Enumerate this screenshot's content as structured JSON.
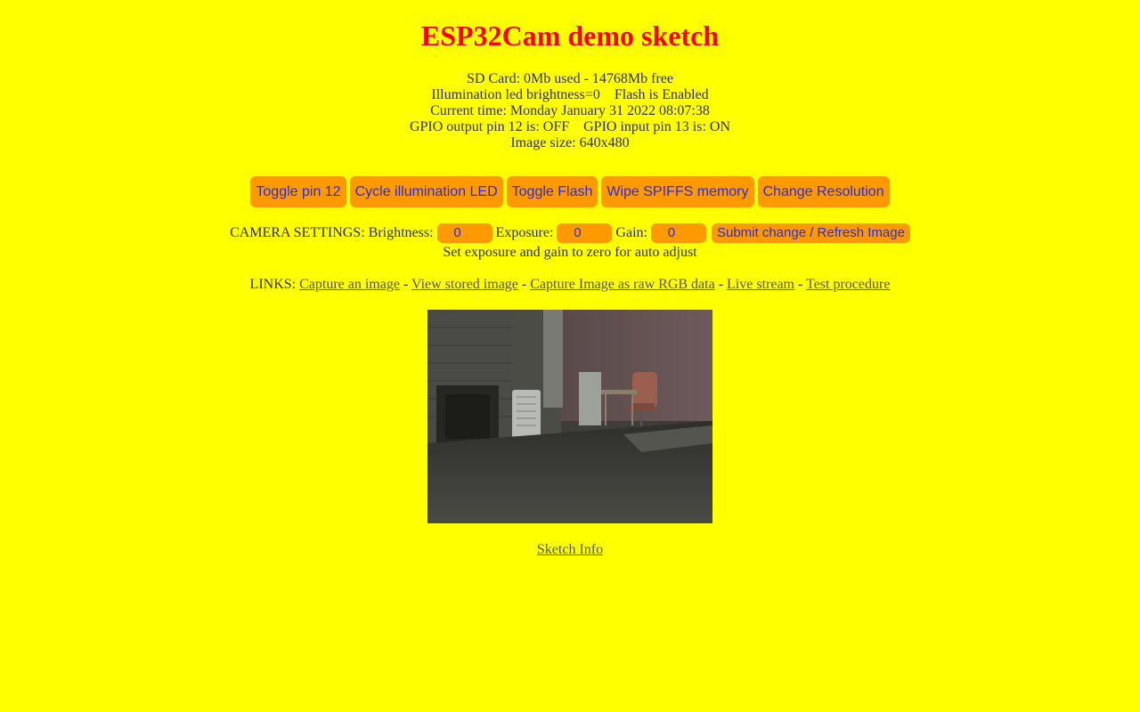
{
  "page": {
    "title": "ESP32Cam demo sketch",
    "background_color": "#ffff00",
    "title_color": "#ff0000",
    "button_color": "#ff9900",
    "button_text_color": "#2b2bd6"
  },
  "status": {
    "sd_card": "SD Card: 0Mb used - 14768Mb free",
    "illumination": "Illumination led brightness=0",
    "flash": "Flash is Enabled",
    "current_time": "Current time: Monday January 31 2022 08:07:38",
    "gpio_output": "GPIO output pin 12 is: OFF",
    "gpio_input": "GPIO input pin 13 is: ON",
    "image_size": "Image size: 640x480"
  },
  "buttons": {
    "toggle_pin": "Toggle pin 12",
    "cycle_led": "Cycle illumination LED",
    "toggle_flash": "Toggle Flash",
    "wipe_spiffs": "Wipe SPIFFS memory",
    "change_resolution": "Change Resolution"
  },
  "camera_settings": {
    "label": "CAMERA SETTINGS:",
    "brightness_label": "Brightness:",
    "brightness_value": "0",
    "exposure_label": "Exposure:",
    "exposure_value": "0",
    "gain_label": "Gain:",
    "gain_value": "0",
    "submit_label": "Submit change / Refresh Image",
    "note": "Set exposure and gain to zero for auto adjust"
  },
  "links": {
    "label": "LINKS:",
    "separator": "-",
    "capture": "Capture an image",
    "view_stored": "View stored image",
    "capture_raw": "Capture Image as raw RGB data",
    "live_stream": "Live stream",
    "test_procedure": "Test procedure"
  },
  "footer": {
    "sketch_info": "Sketch Info"
  }
}
